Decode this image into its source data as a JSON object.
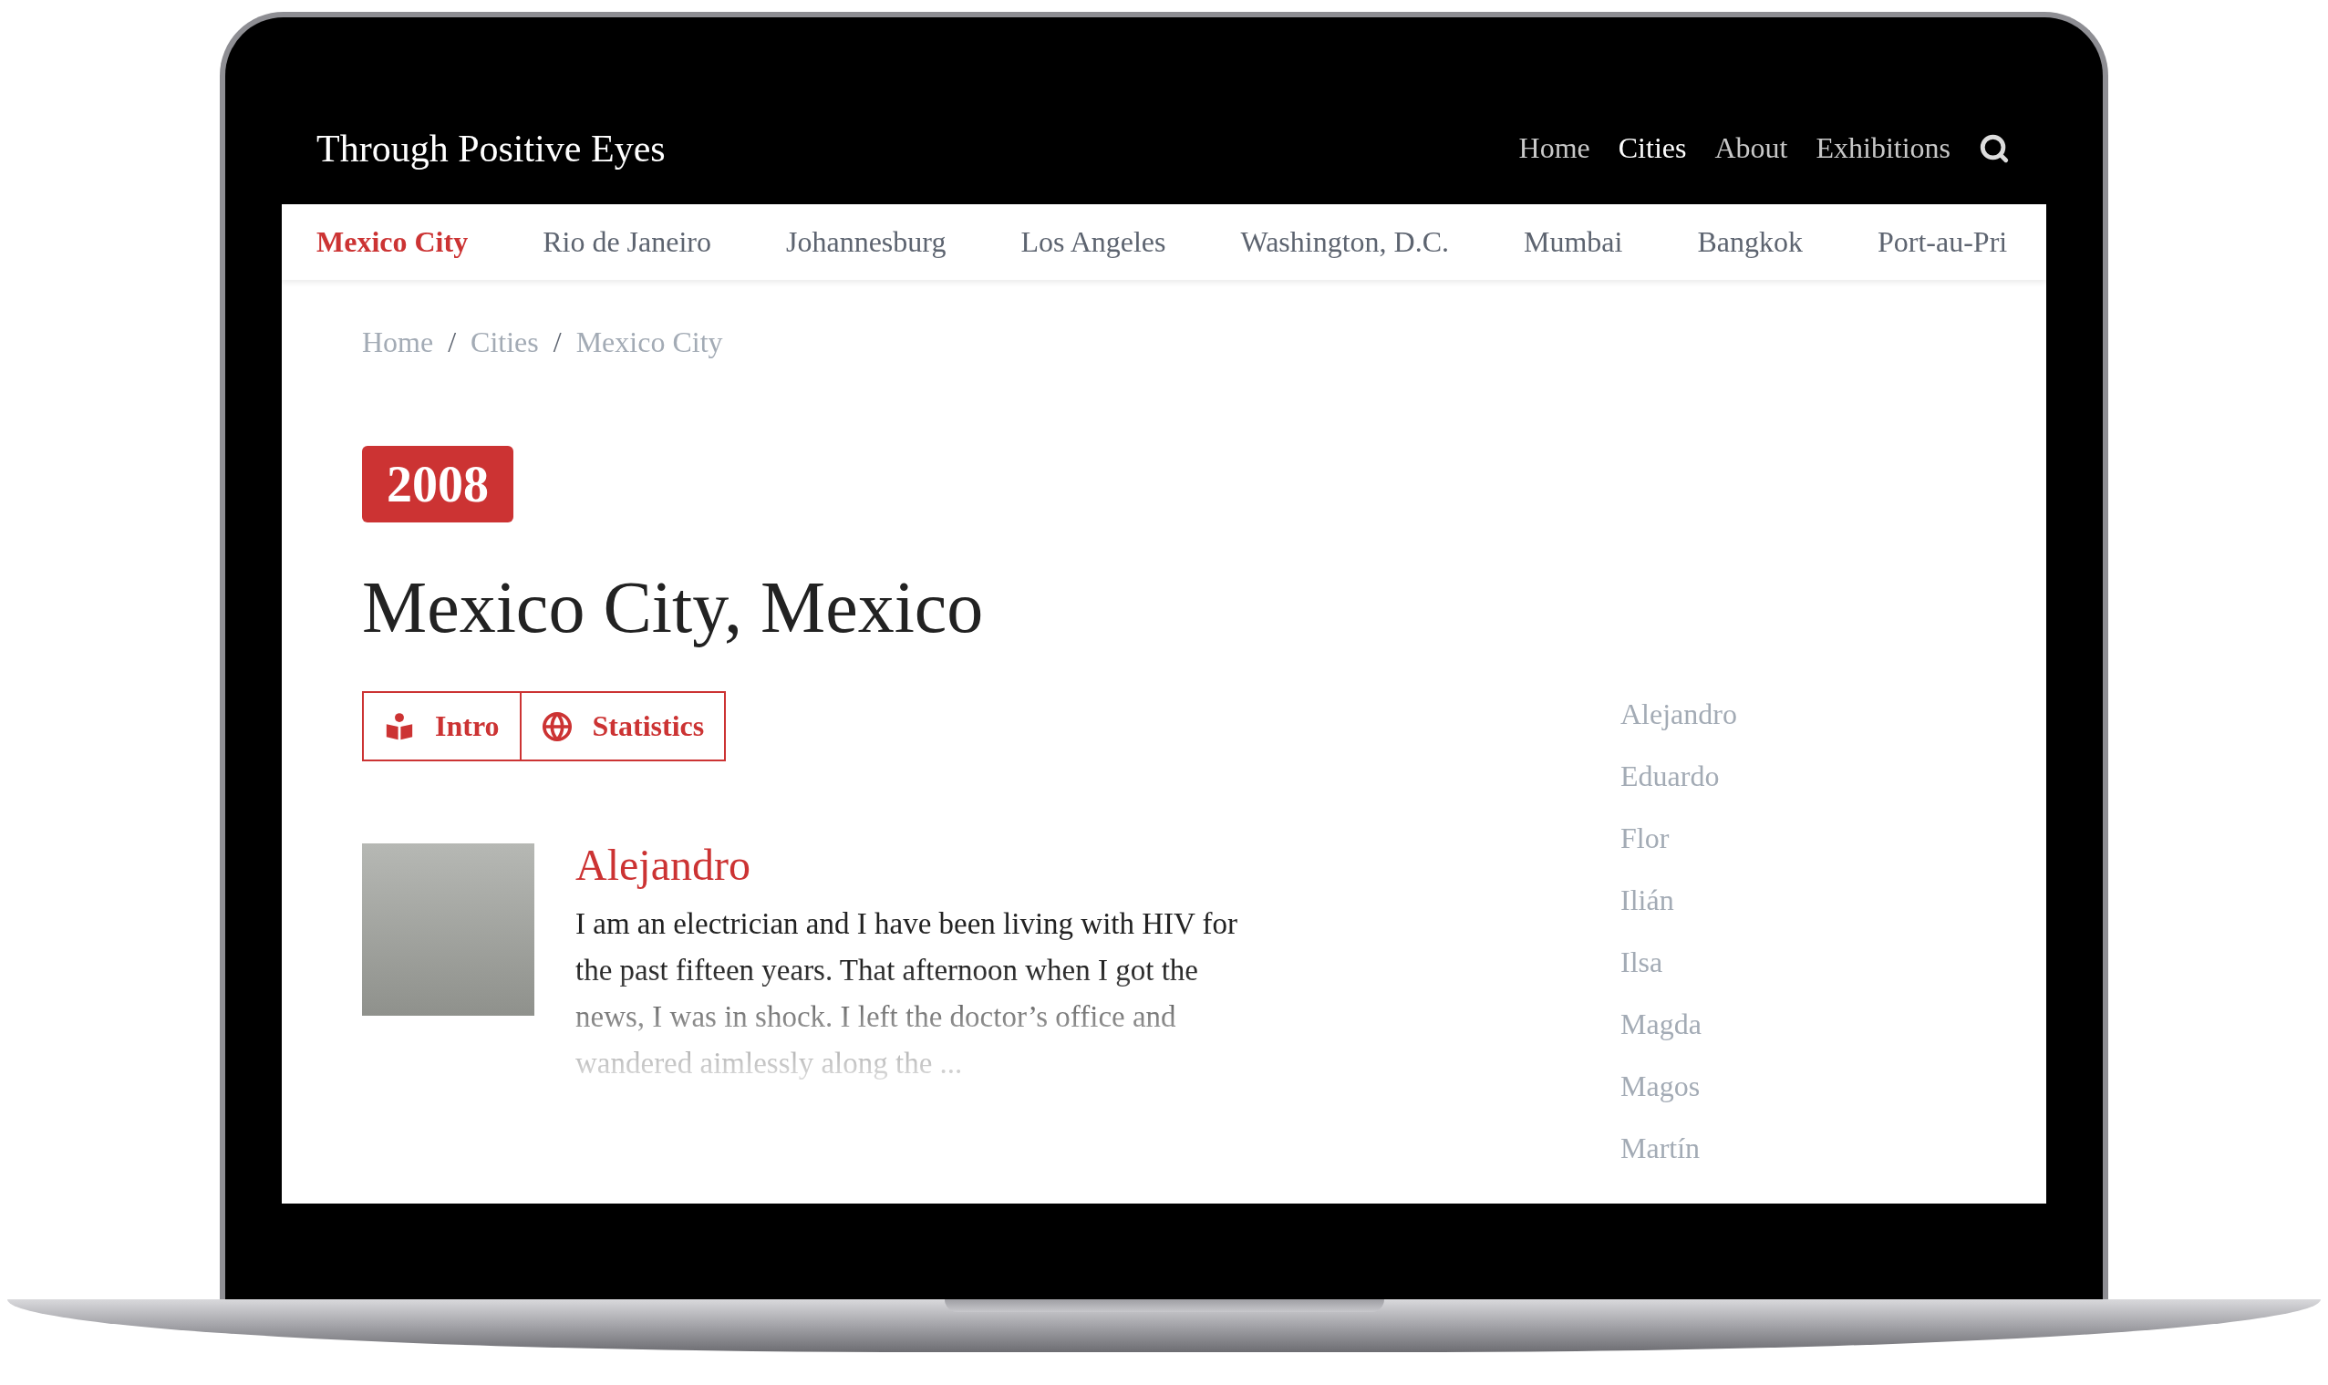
{
  "site": {
    "title": "Through Positive Eyes"
  },
  "nav": [
    {
      "label": "Home",
      "selected": false
    },
    {
      "label": "Cities",
      "selected": true
    },
    {
      "label": "About",
      "selected": false
    },
    {
      "label": "Exhibitions",
      "selected": false
    }
  ],
  "city_tabs": [
    {
      "label": "Mexico City",
      "selected": true
    },
    {
      "label": "Rio de Janeiro",
      "selected": false
    },
    {
      "label": "Johannesburg",
      "selected": false
    },
    {
      "label": "Los Angeles",
      "selected": false
    },
    {
      "label": "Washington, D.C.",
      "selected": false
    },
    {
      "label": "Mumbai",
      "selected": false
    },
    {
      "label": "Bangkok",
      "selected": false
    },
    {
      "label": "Port-au-Pri",
      "selected": false
    }
  ],
  "breadcrumb": [
    "Home",
    "Cities",
    "Mexico City"
  ],
  "breadcrumb_separator": "/",
  "year": "2008",
  "heading": "Mexico City, Mexico",
  "buttons": [
    "Intro",
    "Statistics"
  ],
  "story": {
    "name": "Alejandro",
    "text": "I am an electrician and I have been living with HIV for the past fifteen years. That afternoon when I got the news, I was in shock. I left the doctor’s office and wandered aimlessly along the ..."
  },
  "people": [
    "Alejandro",
    "Eduardo",
    "Flor",
    "Ilián",
    "Ilsa",
    "Magda",
    "Magos",
    "Martín"
  ]
}
